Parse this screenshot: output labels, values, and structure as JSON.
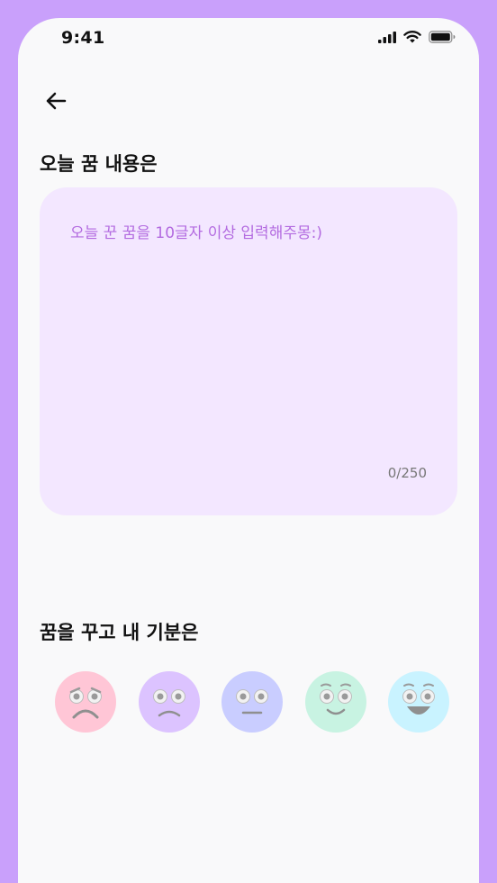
{
  "status_bar": {
    "time": "9:41",
    "icons": [
      "signal-icon",
      "wifi-icon",
      "battery-icon"
    ]
  },
  "header": {
    "back_icon": "arrow-left-icon"
  },
  "dream_section": {
    "title": "오늘 꿈 내용은",
    "placeholder": "오늘 꾼 꿈을 10글자 이상 입력해주몽:)",
    "value": "",
    "counter": "0/250"
  },
  "mood_section": {
    "title": "꿈을 꾸고 내 기분은",
    "options": [
      {
        "name": "very-sad",
        "color": "#ffc6d6"
      },
      {
        "name": "sad",
        "color": "#dcc3ff"
      },
      {
        "name": "neutral",
        "color": "#c9cdff"
      },
      {
        "name": "happy",
        "color": "#c8f3e2"
      },
      {
        "name": "very-happy",
        "color": "#c9f3ff"
      }
    ]
  },
  "colors": {
    "frame": "#c9a0fb",
    "screen": "#f9f9fa",
    "input_background": "#f3e7ff",
    "placeholder": "#b36be0"
  }
}
